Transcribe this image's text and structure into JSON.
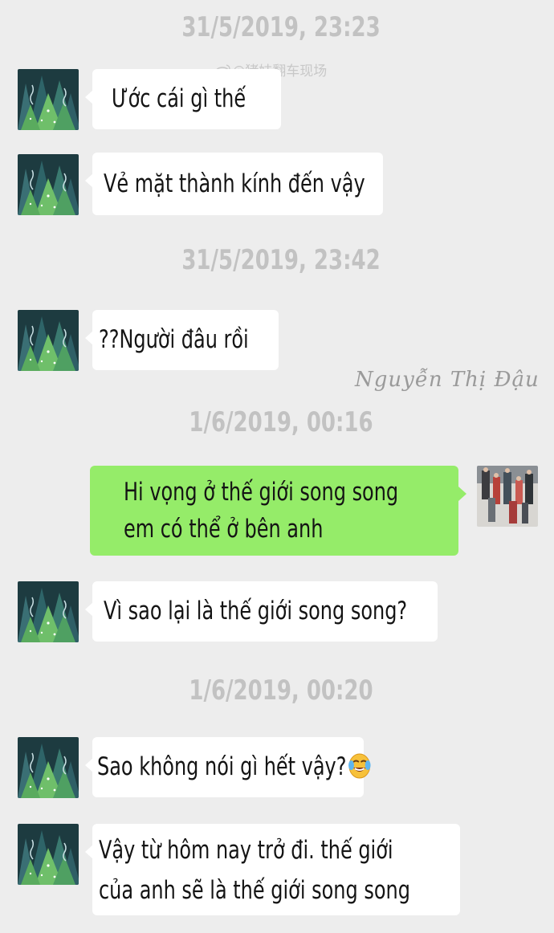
{
  "watermark": "@猪妹翻车现场",
  "signature": "Nguyễn Thị Đậu",
  "timestamps": [
    "31/5/2019, 23:23",
    "31/5/2019, 23:42",
    "1/6/2019, 00:16",
    "1/6/2019, 00:20"
  ],
  "messages": [
    {
      "sender": "other",
      "text": "Ước cái gì thế"
    },
    {
      "sender": "other",
      "text": "Vẻ mặt thành kính đến vậy"
    },
    {
      "sender": "other",
      "text": "??Người đâu rồi"
    },
    {
      "sender": "me",
      "lines": [
        "Hi vọng ở thế giới song song",
        "em có thể ở bên anh"
      ]
    },
    {
      "sender": "other",
      "text": "Vì sao lại là thế giới song song?"
    },
    {
      "sender": "other",
      "text": "Sao không nói gì hết vậy?",
      "emoji": "grinning-tears-emoji"
    },
    {
      "sender": "other",
      "lines": [
        "Vậy từ hôm nay trở đi. thế giới",
        "của anh sẽ là thế giới song song"
      ]
    }
  ],
  "colors": {
    "background": "#ededed",
    "bubble_other": "#ffffff",
    "bubble_me": "#95ec69",
    "timestamp": "#c2c2c2"
  },
  "icons": {
    "avatar_other": "forest-avatar-icon",
    "avatar_me": "crowd-photo-avatar-icon",
    "watermark": "weibo-icon"
  }
}
